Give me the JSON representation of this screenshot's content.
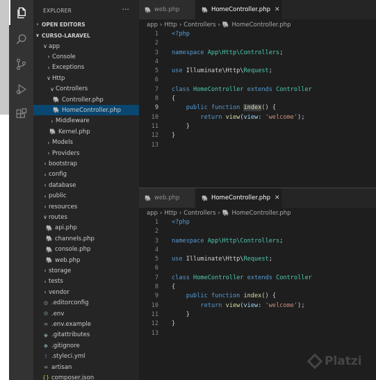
{
  "explorer": {
    "title": "EXPLORER",
    "more": "···",
    "open_editors": "OPEN EDITORS",
    "project": "CURSO-LARAVEL",
    "tree": [
      {
        "label": "app",
        "twist": "∨",
        "icon": "",
        "indent": 0
      },
      {
        "label": "Console",
        "twist": "›",
        "icon": "",
        "indent": 1
      },
      {
        "label": "Exceptions",
        "twist": "›",
        "icon": "",
        "indent": 1
      },
      {
        "label": "Http",
        "twist": "∨",
        "icon": "",
        "indent": 1
      },
      {
        "label": "Controllers",
        "twist": "∨",
        "icon": "",
        "indent": 2
      },
      {
        "label": "Controller.php",
        "twist": "",
        "icon": "php",
        "indent": 3
      },
      {
        "label": "HomeController.php",
        "twist": "",
        "icon": "php",
        "indent": 3,
        "selected": true
      },
      {
        "label": "Middleware",
        "twist": "›",
        "icon": "",
        "indent": 2
      },
      {
        "label": "Kernel.php",
        "twist": "",
        "icon": "php",
        "indent": 2
      },
      {
        "label": "Models",
        "twist": "›",
        "icon": "",
        "indent": 1
      },
      {
        "label": "Providers",
        "twist": "›",
        "icon": "",
        "indent": 1
      },
      {
        "label": "bootstrap",
        "twist": "›",
        "icon": "",
        "indent": 0
      },
      {
        "label": "config",
        "twist": "›",
        "icon": "",
        "indent": 0
      },
      {
        "label": "database",
        "twist": "›",
        "icon": "",
        "indent": 0
      },
      {
        "label": "public",
        "twist": "›",
        "icon": "",
        "indent": 0
      },
      {
        "label": "resources",
        "twist": "›",
        "icon": "",
        "indent": 0
      },
      {
        "label": "routes",
        "twist": "∨",
        "icon": "",
        "indent": 0
      },
      {
        "label": "api.php",
        "twist": "",
        "icon": "php",
        "indent": 1
      },
      {
        "label": "channels.php",
        "twist": "",
        "icon": "php",
        "indent": 1
      },
      {
        "label": "console.php",
        "twist": "",
        "icon": "php",
        "indent": 1
      },
      {
        "label": "web.php",
        "twist": "",
        "icon": "php",
        "indent": 1
      },
      {
        "label": "storage",
        "twist": "›",
        "icon": "",
        "indent": 0
      },
      {
        "label": "tests",
        "twist": "›",
        "icon": "",
        "indent": 0
      },
      {
        "label": "vendor",
        "twist": "›",
        "icon": "",
        "indent": 0
      },
      {
        "label": ".editorconfig",
        "twist": "",
        "icon": "gear",
        "indent": 0
      },
      {
        "label": ".env",
        "twist": "",
        "icon": "gear",
        "indent": 0
      },
      {
        "label": ".env.example",
        "twist": "",
        "icon": "lines",
        "indent": 0
      },
      {
        "label": ".gitattributes",
        "twist": "",
        "icon": "diamond",
        "indent": 0
      },
      {
        "label": ".gitignore",
        "twist": "",
        "icon": "diamond",
        "indent": 0
      },
      {
        "label": ".styleci.yml",
        "twist": "",
        "icon": "yml",
        "indent": 0
      },
      {
        "label": "artisan",
        "twist": "",
        "icon": "lines",
        "indent": 0
      },
      {
        "label": "composer.json",
        "twist": "",
        "icon": "json",
        "indent": 0
      }
    ]
  },
  "panes": [
    {
      "tabs": [
        {
          "label": "web.php",
          "active": false
        },
        {
          "label": "HomeController.php",
          "active": true,
          "close": "✕"
        }
      ],
      "breadcrumb": [
        "app",
        "Http",
        "Controllers",
        "HomeController.php"
      ],
      "current_line": 9,
      "highlight_index": true
    },
    {
      "tabs": [
        {
          "label": "web.php",
          "active": false
        },
        {
          "label": "HomeController.php",
          "active": true,
          "close": "✕"
        }
      ],
      "breadcrumb": [
        "app",
        "Http",
        "Controllers",
        "HomeController.php"
      ],
      "current_line": 0,
      "highlight_index": false
    }
  ],
  "code_lines": [
    [
      {
        "t": "<?php",
        "c": "kw"
      }
    ],
    [],
    [
      {
        "t": "namespace ",
        "c": "kw"
      },
      {
        "t": "App\\Http\\Controllers",
        "c": "cls"
      },
      {
        "t": ";",
        "c": ""
      }
    ],
    [],
    [
      {
        "t": "use ",
        "c": "kw"
      },
      {
        "t": "Illuminate\\Http\\",
        "c": ""
      },
      {
        "t": "Request",
        "c": "cls"
      },
      {
        "t": ";",
        "c": ""
      }
    ],
    [],
    [
      {
        "t": "class ",
        "c": "kw"
      },
      {
        "t": "HomeController ",
        "c": "cls"
      },
      {
        "t": "extends ",
        "c": "kw"
      },
      {
        "t": "Controller",
        "c": "cls"
      }
    ],
    [
      {
        "t": "{",
        "c": ""
      }
    ],
    [
      {
        "t": "    public function ",
        "c": "kw"
      },
      {
        "t": "index",
        "c": "fn idx"
      },
      {
        "t": "() {",
        "c": ""
      }
    ],
    [
      {
        "t": "        return ",
        "c": "kw"
      },
      {
        "t": "view",
        "c": "fn"
      },
      {
        "t": "(",
        "c": ""
      },
      {
        "t": "view",
        "c": "param"
      },
      {
        "t": ": ",
        "c": ""
      },
      {
        "t": "'welcome'",
        "c": "str"
      },
      {
        "t": ");",
        "c": ""
      }
    ],
    [
      {
        "t": "    }",
        "c": ""
      }
    ],
    [
      {
        "t": "}",
        "c": ""
      }
    ],
    []
  ],
  "watermark": "Platzi"
}
